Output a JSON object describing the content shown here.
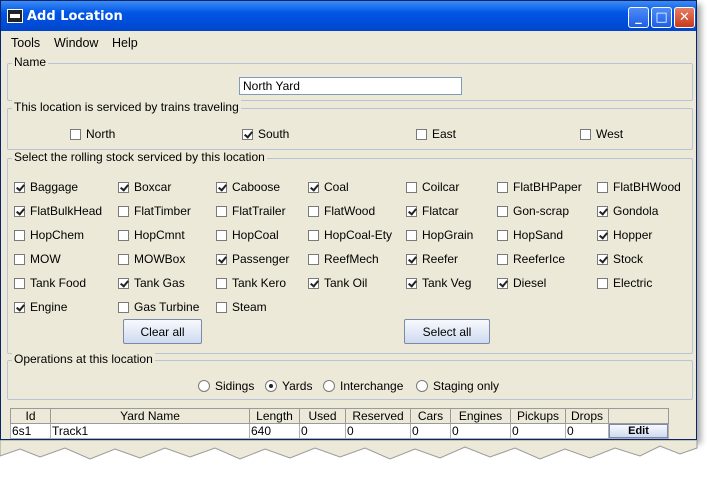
{
  "window": {
    "title": "Add Location"
  },
  "menu": [
    "Tools",
    "Window",
    "Help"
  ],
  "name_panel": {
    "title": "Name",
    "value": "North Yard"
  },
  "direction_panel": {
    "title": "This location is serviced by trains traveling",
    "options": [
      {
        "label": "North",
        "checked": false
      },
      {
        "label": "South",
        "checked": true
      },
      {
        "label": "East",
        "checked": false
      },
      {
        "label": "West",
        "checked": false
      }
    ]
  },
  "rolling_stock_panel": {
    "title": "Select the rolling stock serviced by this location",
    "rows": [
      [
        {
          "label": "Baggage",
          "checked": true
        },
        {
          "label": "Boxcar",
          "checked": true
        },
        {
          "label": "Caboose",
          "checked": true
        },
        {
          "label": "Coal",
          "checked": true
        },
        {
          "label": "Coilcar",
          "checked": false
        },
        {
          "label": "FlatBHPaper",
          "checked": false
        },
        {
          "label": "FlatBHWood",
          "checked": false
        }
      ],
      [
        {
          "label": "FlatBulkHead",
          "checked": true
        },
        {
          "label": "FlatTimber",
          "checked": false
        },
        {
          "label": "FlatTrailer",
          "checked": false
        },
        {
          "label": "FlatWood",
          "checked": false
        },
        {
          "label": "Flatcar",
          "checked": true
        },
        {
          "label": "Gon-scrap",
          "checked": false
        },
        {
          "label": "Gondola",
          "checked": true
        }
      ],
      [
        {
          "label": "HopChem",
          "checked": false
        },
        {
          "label": "HopCmnt",
          "checked": false
        },
        {
          "label": "HopCoal",
          "checked": false
        },
        {
          "label": "HopCoal-Ety",
          "checked": false
        },
        {
          "label": "HopGrain",
          "checked": false
        },
        {
          "label": "HopSand",
          "checked": false
        },
        {
          "label": "Hopper",
          "checked": true
        }
      ],
      [
        {
          "label": "MOW",
          "checked": false
        },
        {
          "label": "MOWBox",
          "checked": false
        },
        {
          "label": "Passenger",
          "checked": true
        },
        {
          "label": "ReefMech",
          "checked": false
        },
        {
          "label": "Reefer",
          "checked": true
        },
        {
          "label": "ReeferIce",
          "checked": false
        },
        {
          "label": "Stock",
          "checked": true
        }
      ],
      [
        {
          "label": "Tank Food",
          "checked": false
        },
        {
          "label": "Tank Gas",
          "checked": true
        },
        {
          "label": "Tank Kero",
          "checked": false
        },
        {
          "label": "Tank Oil",
          "checked": true
        },
        {
          "label": "Tank Veg",
          "checked": true
        },
        {
          "label": "Diesel",
          "checked": true
        },
        {
          "label": "Electric",
          "checked": false
        }
      ],
      [
        {
          "label": "Engine",
          "checked": true
        },
        {
          "label": "Gas Turbine",
          "checked": false
        },
        {
          "label": "Steam",
          "checked": false
        }
      ]
    ],
    "clear_all_label": "Clear all",
    "select_all_label": "Select all"
  },
  "operations_panel": {
    "title": "Operations at this location",
    "options": [
      {
        "label": "Sidings",
        "selected": false
      },
      {
        "label": "Yards",
        "selected": true
      },
      {
        "label": "Interchange",
        "selected": false
      },
      {
        "label": "Staging only",
        "selected": false
      }
    ]
  },
  "tracks_table": {
    "headers": [
      "Id",
      "Yard Name",
      "Length",
      "Used",
      "Reserved",
      "Cars",
      "Engines",
      "Pickups",
      "Drops",
      ""
    ],
    "rows": [
      {
        "id": "6s1",
        "name": "Track1",
        "length": "640",
        "used": "0",
        "reserved": "0",
        "cars": "0",
        "engines": "0",
        "pickups": "0",
        "drops": "0",
        "action": "Edit"
      }
    ]
  }
}
